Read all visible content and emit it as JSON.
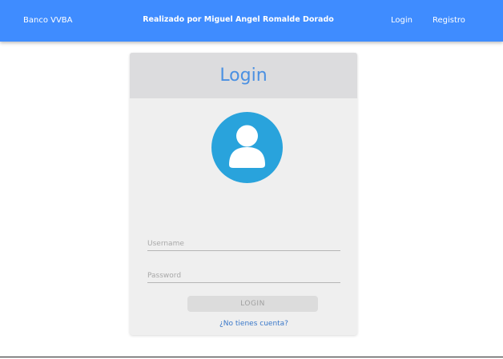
{
  "navbar": {
    "brand": "Banco VVBA",
    "credit": "Realizado por Miguel Angel Romalde Dorado",
    "links": [
      {
        "label": "Login"
      },
      {
        "label": "Registro"
      }
    ],
    "background_color": "#3f8cff"
  },
  "login_card": {
    "title": "Login",
    "avatar_icon": "user-icon",
    "avatar_color": "#29a3dc",
    "username": {
      "placeholder": "Username",
      "value": ""
    },
    "password": {
      "placeholder": "Password",
      "value": ""
    },
    "submit_label": "LOGIN",
    "register_link": "¿No tienes cuenta?"
  }
}
